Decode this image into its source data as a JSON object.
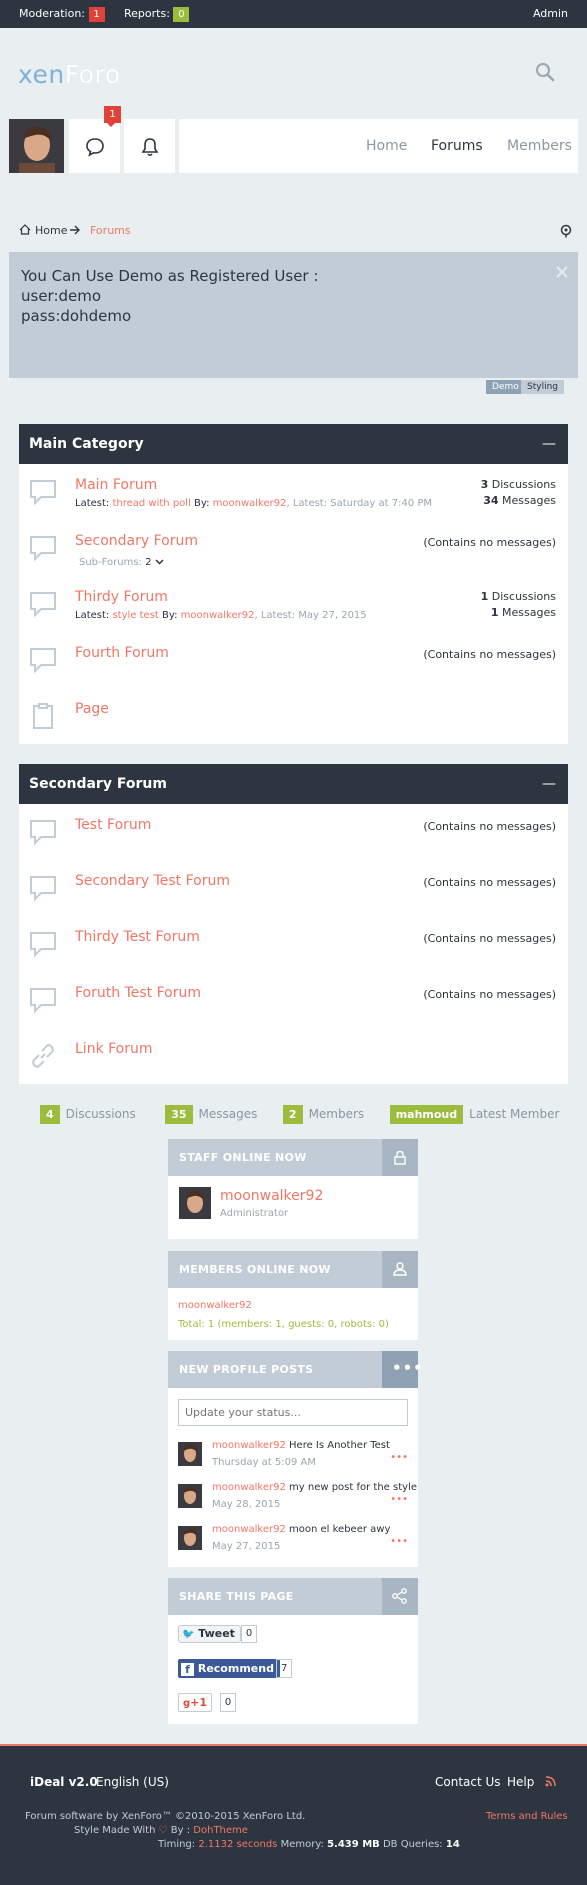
{
  "topbar": {
    "moderation_label": "Moderation:",
    "moderation_count": "1",
    "reports_label": "Reports:",
    "reports_count": "0",
    "admin_label": "Admin"
  },
  "logo": {
    "part1": "xen",
    "part2": "Foro"
  },
  "nav": {
    "alert_count": "1",
    "links": [
      "Home",
      "Forums",
      "Members"
    ]
  },
  "breadcrumb": {
    "home": "Home",
    "current": "Forums"
  },
  "notice": {
    "line1": "You Can Use Demo as Registered User :",
    "line2": "user:demo",
    "line3": "pass:dohdemo",
    "tab_demo": "Demo",
    "tab_styling": "Styling"
  },
  "main_category": {
    "title": "Main Category",
    "collapse": "—",
    "nodes": [
      {
        "title": "Main Forum",
        "latest_label": "Latest:",
        "latest_thread": "thread with poll",
        "by_label": "By:",
        "latest_user": "moonwalker92",
        "latest_date": ", Latest: Saturday at 7:40 PM",
        "discussions": "3",
        "discussions_label": "Discussions",
        "messages": "34",
        "messages_label": "Messages"
      },
      {
        "title": "Secondary Forum",
        "subforums": "Sub-Forums:",
        "subforums_count": "2",
        "nomsg": "(Contains no messages)"
      },
      {
        "title": "Thirdy Forum",
        "latest_label": "Latest:",
        "latest_thread": "style test",
        "by_label": "By:",
        "latest_user": "moonwalker92",
        "latest_date": ", Latest: May 27, 2015",
        "discussions": "1",
        "discussions_label": "Discussions",
        "messages": "1",
        "messages_label": "Messages"
      },
      {
        "title": "Fourth Forum",
        "nomsg": "(Contains no messages)"
      },
      {
        "title": "Page"
      }
    ]
  },
  "secondary_category": {
    "title": "Secondary Forum",
    "collapse": "—",
    "nodes": [
      {
        "title": "Test Forum",
        "nomsg": "(Contains no messages)"
      },
      {
        "title": "Secondary Test Forum",
        "nomsg": "(Contains no messages)"
      },
      {
        "title": "Thirdy Test Forum",
        "nomsg": "(Contains no messages)"
      },
      {
        "title": "Foruth Test Forum",
        "nomsg": "(Contains no messages)"
      },
      {
        "title": "Link Forum"
      }
    ]
  },
  "board_stats": {
    "discussions": "4",
    "discussions_label": "Discussions",
    "messages": "35",
    "messages_label": "Messages",
    "members": "2",
    "members_label": "Members",
    "latest_member": "mahmoud",
    "latest_member_label": "Latest Member"
  },
  "staff_online": {
    "title": "STAFF ONLINE NOW",
    "user": "moonwalker92",
    "role": "Administrator"
  },
  "members_online": {
    "title": "MEMBERS ONLINE NOW",
    "user": "moonwalker92",
    "total": "Total: 1 (members: 1, guests: 0, robots: 0)"
  },
  "profile_posts": {
    "title": "NEW PROFILE POSTS",
    "placeholder": "Update your status...",
    "posts": [
      {
        "user": "moonwalker92",
        "text": "Here Is Another Test",
        "date": "Thursday at 5:09 AM"
      },
      {
        "user": "moonwalker92",
        "text": "my new post for the style",
        "date": "May 28, 2015"
      },
      {
        "user": "moonwalker92",
        "text": "moon el kebeer awy",
        "date": "May 27, 2015"
      }
    ]
  },
  "share": {
    "title": "SHARE THIS PAGE",
    "tweet": "Tweet",
    "tweet_count": "0",
    "recommend": "Recommend",
    "recommend_count": "7",
    "gplus": "+1",
    "gplus_count": "0"
  },
  "footer": {
    "style": "iDeal v2.0",
    "language": "English (US)",
    "contact": "Contact Us",
    "help": "Help",
    "copyright": "Forum software by XenForo™ ©2010-2015 XenForo Ltd.",
    "made_with": "Style Made With",
    "by": "By :",
    "dohtheme": "DohTheme",
    "terms": "Terms and Rules",
    "timing_label": "Timing:",
    "timing_value": "2.1132 seconds",
    "memory_label": "Memory:",
    "memory_value": "5.439 MB",
    "queries_label": "DB Queries:",
    "queries_value": "14"
  },
  "colors": {
    "dark": "#2d3540",
    "accent": "#f07766",
    "green": "#9bbc3d",
    "red": "#e0423a",
    "steel": "#c1ccd6"
  }
}
